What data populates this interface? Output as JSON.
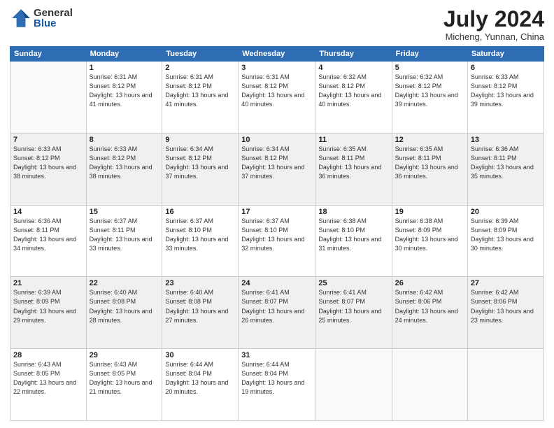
{
  "logo": {
    "general": "General",
    "blue": "Blue"
  },
  "title": "July 2024",
  "location": "Micheng, Yunnan, China",
  "days_of_week": [
    "Sunday",
    "Monday",
    "Tuesday",
    "Wednesday",
    "Thursday",
    "Friday",
    "Saturday"
  ],
  "weeks": [
    [
      {
        "day": "",
        "info": ""
      },
      {
        "day": "1",
        "info": "Sunrise: 6:31 AM\nSunset: 8:12 PM\nDaylight: 13 hours\nand 41 minutes."
      },
      {
        "day": "2",
        "info": "Sunrise: 6:31 AM\nSunset: 8:12 PM\nDaylight: 13 hours\nand 41 minutes."
      },
      {
        "day": "3",
        "info": "Sunrise: 6:31 AM\nSunset: 8:12 PM\nDaylight: 13 hours\nand 40 minutes."
      },
      {
        "day": "4",
        "info": "Sunrise: 6:32 AM\nSunset: 8:12 PM\nDaylight: 13 hours\nand 40 minutes."
      },
      {
        "day": "5",
        "info": "Sunrise: 6:32 AM\nSunset: 8:12 PM\nDaylight: 13 hours\nand 39 minutes."
      },
      {
        "day": "6",
        "info": "Sunrise: 6:33 AM\nSunset: 8:12 PM\nDaylight: 13 hours\nand 39 minutes."
      }
    ],
    [
      {
        "day": "7",
        "info": ""
      },
      {
        "day": "8",
        "info": "Sunrise: 6:33 AM\nSunset: 8:12 PM\nDaylight: 13 hours\nand 38 minutes."
      },
      {
        "day": "9",
        "info": "Sunrise: 6:34 AM\nSunset: 8:12 PM\nDaylight: 13 hours\nand 37 minutes."
      },
      {
        "day": "10",
        "info": "Sunrise: 6:34 AM\nSunset: 8:12 PM\nDaylight: 13 hours\nand 37 minutes."
      },
      {
        "day": "11",
        "info": "Sunrise: 6:35 AM\nSunset: 8:11 PM\nDaylight: 13 hours\nand 36 minutes."
      },
      {
        "day": "12",
        "info": "Sunrise: 6:35 AM\nSunset: 8:11 PM\nDaylight: 13 hours\nand 36 minutes."
      },
      {
        "day": "13",
        "info": "Sunrise: 6:36 AM\nSunset: 8:11 PM\nDaylight: 13 hours\nand 35 minutes."
      }
    ],
    [
      {
        "day": "14",
        "info": ""
      },
      {
        "day": "15",
        "info": "Sunrise: 6:37 AM\nSunset: 8:11 PM\nDaylight: 13 hours\nand 33 minutes."
      },
      {
        "day": "16",
        "info": "Sunrise: 6:37 AM\nSunset: 8:10 PM\nDaylight: 13 hours\nand 33 minutes."
      },
      {
        "day": "17",
        "info": "Sunrise: 6:37 AM\nSunset: 8:10 PM\nDaylight: 13 hours\nand 32 minutes."
      },
      {
        "day": "18",
        "info": "Sunrise: 6:38 AM\nSunset: 8:10 PM\nDaylight: 13 hours\nand 31 minutes."
      },
      {
        "day": "19",
        "info": "Sunrise: 6:38 AM\nSunset: 8:09 PM\nDaylight: 13 hours\nand 30 minutes."
      },
      {
        "day": "20",
        "info": "Sunrise: 6:39 AM\nSunset: 8:09 PM\nDaylight: 13 hours\nand 30 minutes."
      }
    ],
    [
      {
        "day": "21",
        "info": ""
      },
      {
        "day": "22",
        "info": "Sunrise: 6:40 AM\nSunset: 8:08 PM\nDaylight: 13 hours\nand 28 minutes."
      },
      {
        "day": "23",
        "info": "Sunrise: 6:40 AM\nSunset: 8:08 PM\nDaylight: 13 hours\nand 27 minutes."
      },
      {
        "day": "24",
        "info": "Sunrise: 6:41 AM\nSunset: 8:07 PM\nDaylight: 13 hours\nand 26 minutes."
      },
      {
        "day": "25",
        "info": "Sunrise: 6:41 AM\nSunset: 8:07 PM\nDaylight: 13 hours\nand 25 minutes."
      },
      {
        "day": "26",
        "info": "Sunrise: 6:42 AM\nSunset: 8:06 PM\nDaylight: 13 hours\nand 24 minutes."
      },
      {
        "day": "27",
        "info": "Sunrise: 6:42 AM\nSunset: 8:06 PM\nDaylight: 13 hours\nand 23 minutes."
      }
    ],
    [
      {
        "day": "28",
        "info": "Sunrise: 6:43 AM\nSunset: 8:05 PM\nDaylight: 13 hours\nand 22 minutes."
      },
      {
        "day": "29",
        "info": "Sunrise: 6:43 AM\nSunset: 8:05 PM\nDaylight: 13 hours\nand 21 minutes."
      },
      {
        "day": "30",
        "info": "Sunrise: 6:44 AM\nSunset: 8:04 PM\nDaylight: 13 hours\nand 20 minutes."
      },
      {
        "day": "31",
        "info": "Sunrise: 6:44 AM\nSunset: 8:04 PM\nDaylight: 13 hours\nand 19 minutes."
      },
      {
        "day": "",
        "info": ""
      },
      {
        "day": "",
        "info": ""
      },
      {
        "day": "",
        "info": ""
      }
    ]
  ],
  "week1_day7_info": "Sunrise: 6:33 AM\nSunset: 8:12 PM\nDaylight: 13 hours\nand 38 minutes.",
  "week3_day14_info": "Sunrise: 6:36 AM\nSunset: 8:11 PM\nDaylight: 13 hours\nand 34 minutes.",
  "week4_day21_info": "Sunrise: 6:39 AM\nSunset: 8:09 PM\nDaylight: 13 hours\nand 29 minutes."
}
